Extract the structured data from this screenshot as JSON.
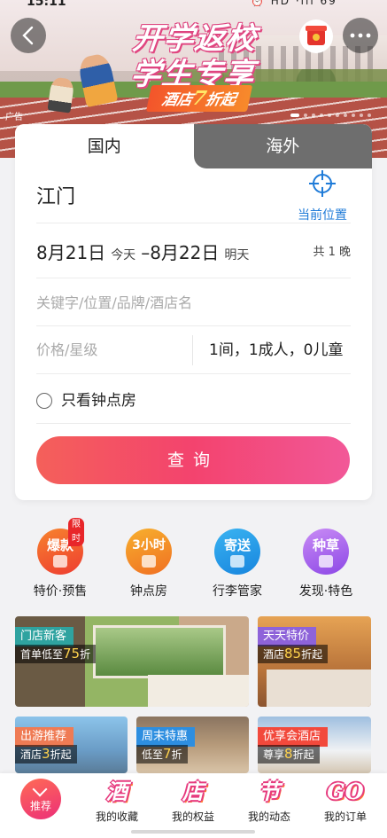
{
  "status_bar": {
    "time": "15:11",
    "icons": "⏰ HD ·ıll 69"
  },
  "banner": {
    "title_line1": "开学返校",
    "title_line2": "学生专享",
    "promo_prefix": "酒店",
    "promo_number": "7",
    "promo_suffix": "折起",
    "ad_tag": "广告",
    "carousel_count": 10,
    "carousel_active_index": 0
  },
  "tabs": {
    "domestic": "国内",
    "overseas": "海外"
  },
  "search": {
    "city": "江门",
    "current_location": "当前位置",
    "check_in_date": "8月21日",
    "check_in_label": "今天",
    "dash": "–",
    "check_out_date": "8月22日",
    "check_out_label": "明天",
    "nights": "共 1 晚",
    "keyword_placeholder": "关键字/位置/品牌/酒店名",
    "price_placeholder": "价格/星级",
    "guests": "1间，1成人，0儿童",
    "hourly_only": "只看钟点房",
    "query_button": "查询"
  },
  "quick_entries": [
    {
      "icon_text": "爆款",
      "label": "特价·预售",
      "badge": "限时"
    },
    {
      "icon_text": "3小时",
      "label": "钟点房"
    },
    {
      "icon_text": "寄送",
      "label": "行李管家"
    },
    {
      "icon_text": "种草",
      "label": "发现·特色"
    }
  ],
  "tiles": [
    {
      "title": "门店新客",
      "sub_prefix": "首单低至",
      "sub_highlight": "75",
      "sub_suffix": "折"
    },
    {
      "title": "天天特价",
      "sub_prefix": "酒店",
      "sub_highlight": "85",
      "sub_suffix": "折起"
    },
    {
      "title": "出游推荐",
      "sub_prefix": "酒店",
      "sub_highlight": "3",
      "sub_suffix": "折起"
    },
    {
      "title": "周末特惠",
      "sub_prefix": "低至",
      "sub_highlight": "7",
      "sub_suffix": "折"
    },
    {
      "title": "优享会酒店",
      "sub_prefix": "尊享",
      "sub_highlight": "8",
      "sub_suffix": "折起"
    }
  ],
  "bottom_nav": [
    {
      "glyph": "",
      "label": "推荐"
    },
    {
      "glyph": "酒",
      "label": "我的收藏"
    },
    {
      "glyph": "店",
      "label": "我的权益"
    },
    {
      "glyph": "节",
      "label": "我的动态"
    },
    {
      "glyph": "GO",
      "label": "我的订单"
    }
  ],
  "colors": {
    "accent_blue": "#1f7bd8",
    "query_gradient_start": "#f4605a",
    "query_gradient_end": "#f25898"
  }
}
